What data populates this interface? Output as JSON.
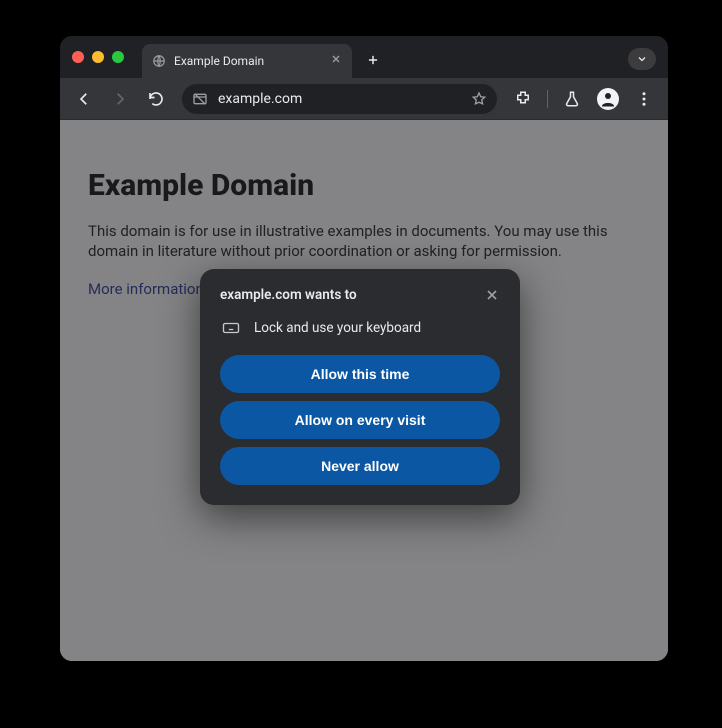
{
  "tab": {
    "title": "Example Domain"
  },
  "omnibox": {
    "url": "example.com"
  },
  "page": {
    "heading": "Example Domain",
    "paragraph": "This domain is for use in illustrative examples in documents. You may use this domain in literature without prior coordination or asking for permission.",
    "link_text": "More information..."
  },
  "dialog": {
    "title": "example.com wants to",
    "permission_text": "Lock and use your keyboard",
    "buttons": {
      "allow_once": "Allow this time",
      "allow_always": "Allow on every visit",
      "never": "Never allow"
    }
  }
}
